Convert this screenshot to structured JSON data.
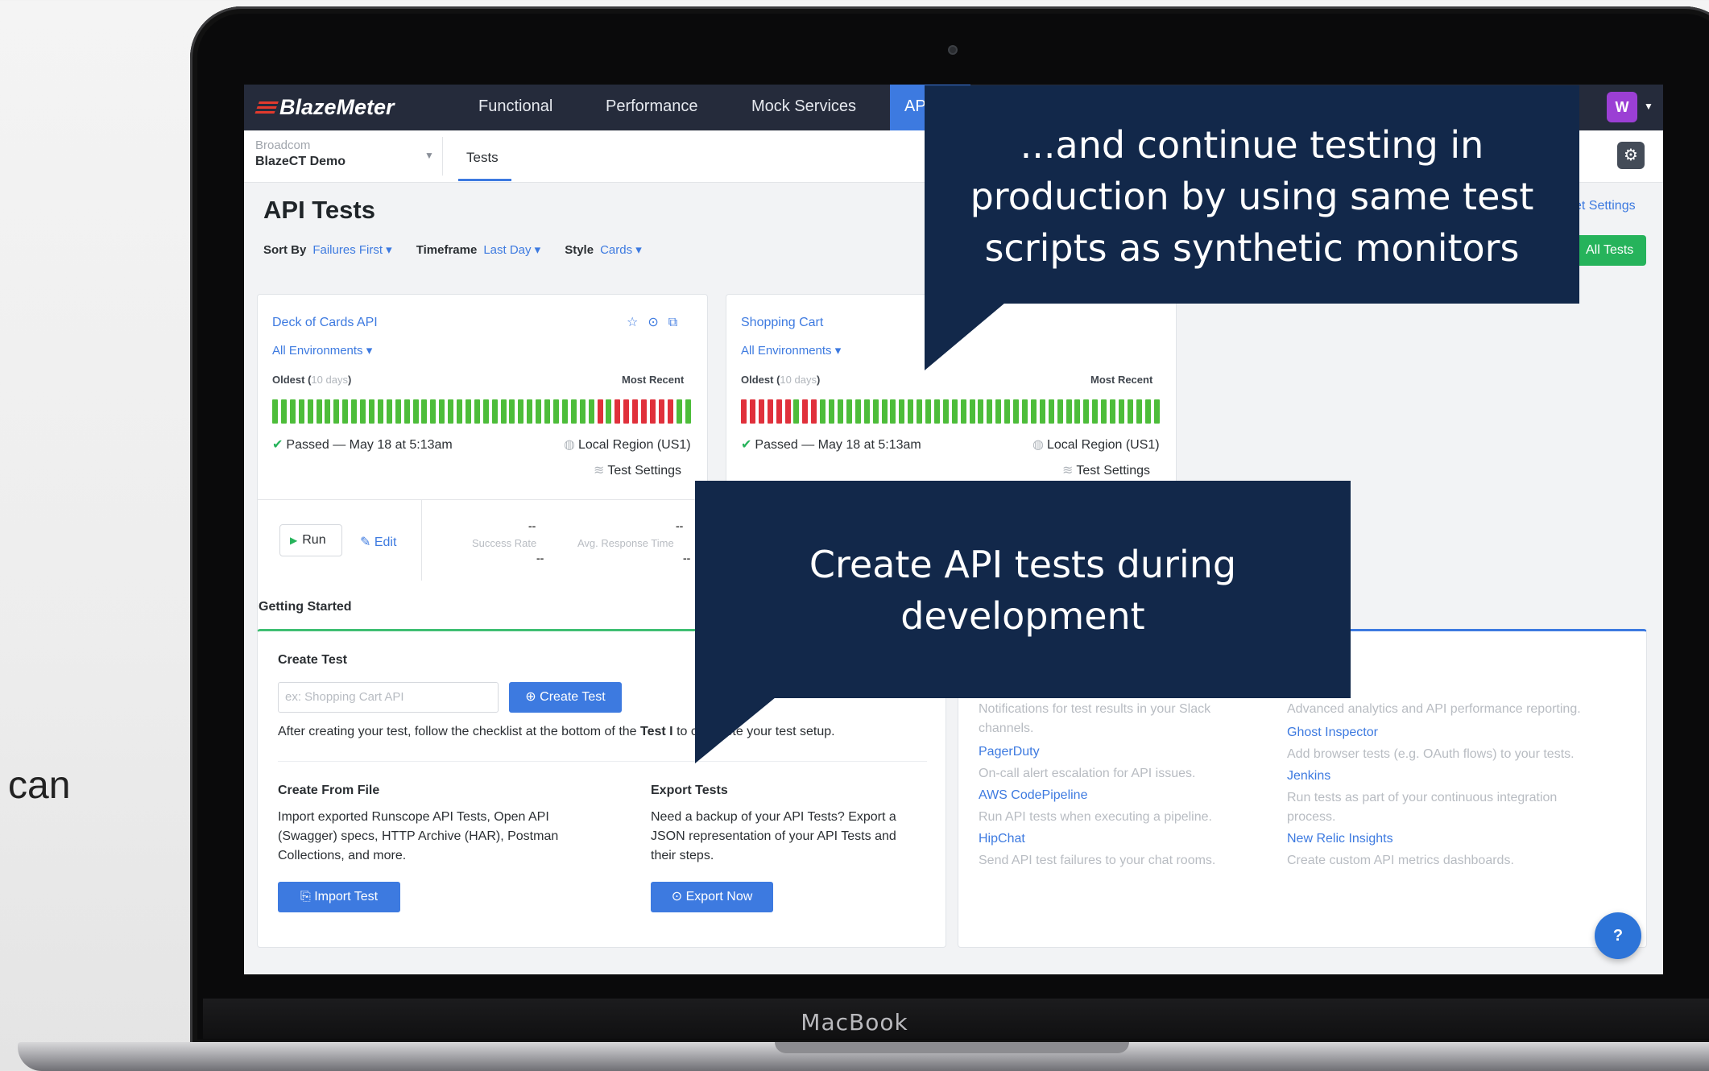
{
  "slide": {
    "side_text": "o can"
  },
  "device": {
    "label": "MacBook"
  },
  "app": {
    "logo": "BlazeMeter",
    "nav": [
      "Functional",
      "Performance",
      "Mock Services",
      "AP"
    ],
    "avatar": "W",
    "org": {
      "parent": "Broadcom",
      "name": "BlazeCT Demo"
    },
    "tab": "Tests",
    "page_title": "API Tests",
    "sort": {
      "label": "Sort By",
      "value": "Failures First ▾"
    },
    "timeframe": {
      "label": "Timeframe",
      "value": "Last Day ▾"
    },
    "style": {
      "label": "Style",
      "value": "Cards ▾"
    },
    "set_link": "et Settings",
    "all_tests_btn": "All Tests",
    "bar_colors": {
      "pass": "#4dbd3a",
      "fail": "#e0303b",
      "accent": "#3d7ae0"
    },
    "cards": [
      {
        "title": "Deck of Cards API",
        "env": "All Environments ▾",
        "oldest": "Oldest (",
        "oldest_days": "10 days",
        "oldest_close": ")",
        "recent": "Most Recent",
        "results": [
          "p",
          "p",
          "p",
          "p",
          "p",
          "p",
          "p",
          "p",
          "p",
          "p",
          "p",
          "p",
          "p",
          "p",
          "p",
          "p",
          "p",
          "p",
          "p",
          "p",
          "p",
          "p",
          "p",
          "p",
          "p",
          "p",
          "p",
          "p",
          "p",
          "p",
          "p",
          "p",
          "p",
          "p",
          "p",
          "p",
          "p",
          "f",
          "p",
          "f",
          "f",
          "f",
          "f",
          "f",
          "f",
          "f",
          "p",
          "p"
        ],
        "status": "Passed — May 18 at 5:13am",
        "region": "Local Region (US1)",
        "settings": "Test Settings"
      },
      {
        "title": "Shopping Cart",
        "env": "All Environments ▾",
        "oldest": "Oldest (",
        "oldest_days": "10 days",
        "oldest_close": ")",
        "recent": "Most Recent",
        "results": [
          "f",
          "f",
          "f",
          "f",
          "f",
          "f",
          "p",
          "f",
          "f",
          "p",
          "p",
          "p",
          "p",
          "p",
          "p",
          "p",
          "p",
          "p",
          "p",
          "p",
          "p",
          "p",
          "p",
          "p",
          "p",
          "p",
          "p",
          "p",
          "p",
          "p",
          "p",
          "p",
          "p",
          "p",
          "p",
          "p",
          "p",
          "p",
          "p",
          "p",
          "p",
          "p",
          "p",
          "p",
          "p",
          "p",
          "p",
          "p"
        ],
        "status": "Passed — May 18 at 5:13am",
        "region": "Local Region (US1)",
        "settings": "Test Settings"
      }
    ],
    "run_btn": "Run",
    "edit_link": "Edit",
    "stats": {
      "success_rate_label": "Success Rate",
      "success_rate_value": "--",
      "avg_label": "Avg. Response Time",
      "avg_value": "--",
      "dash": "--"
    },
    "getting_started": "Getting Started",
    "create_test": {
      "heading": "Create Test",
      "placeholder": "ex: Shopping Cart API",
      "button": "Create Test",
      "note_pre": "After creating your test, follow the checklist at the bottom of the ",
      "note_bold": "Test I",
      "note_post": "to complete your test setup."
    },
    "create_from_file": {
      "heading": "Create From File",
      "text": "Import exported Runscope API Tests, Open API (Swagger) specs, HTTP Archive (HAR), Postman Collections, and more.",
      "button": "Import Test"
    },
    "export_tests": {
      "heading": "Export Tests",
      "text": "Need a backup of your API Tests? Export a JSON representation of your API Tests and their steps.",
      "button": "Export Now"
    },
    "integrations_left": [
      {
        "name": "",
        "desc": "Notifications for test results in your Slack channels."
      },
      {
        "name": "PagerDuty",
        "desc": "On-call alert escalation for API issues."
      },
      {
        "name": "AWS CodePipeline",
        "desc": "Run API tests when executing a pipeline."
      },
      {
        "name": "HipChat",
        "desc": "Send API test failures to your chat rooms."
      }
    ],
    "integrations_right": [
      {
        "name": "",
        "desc": "Advanced analytics and API performance reporting."
      },
      {
        "name": "Ghost Inspector",
        "desc": "Add browser tests (e.g. OAuth flows) to your tests."
      },
      {
        "name": "Jenkins",
        "desc": "Run tests as part of your continuous integration process."
      },
      {
        "name": "New Relic Insights",
        "desc": "Create custom API metrics dashboards."
      }
    ],
    "help": "?"
  },
  "callouts": {
    "top": "...and continue testing in production by using same test scripts as synthetic monitors",
    "bottom": "Create API tests during development"
  }
}
